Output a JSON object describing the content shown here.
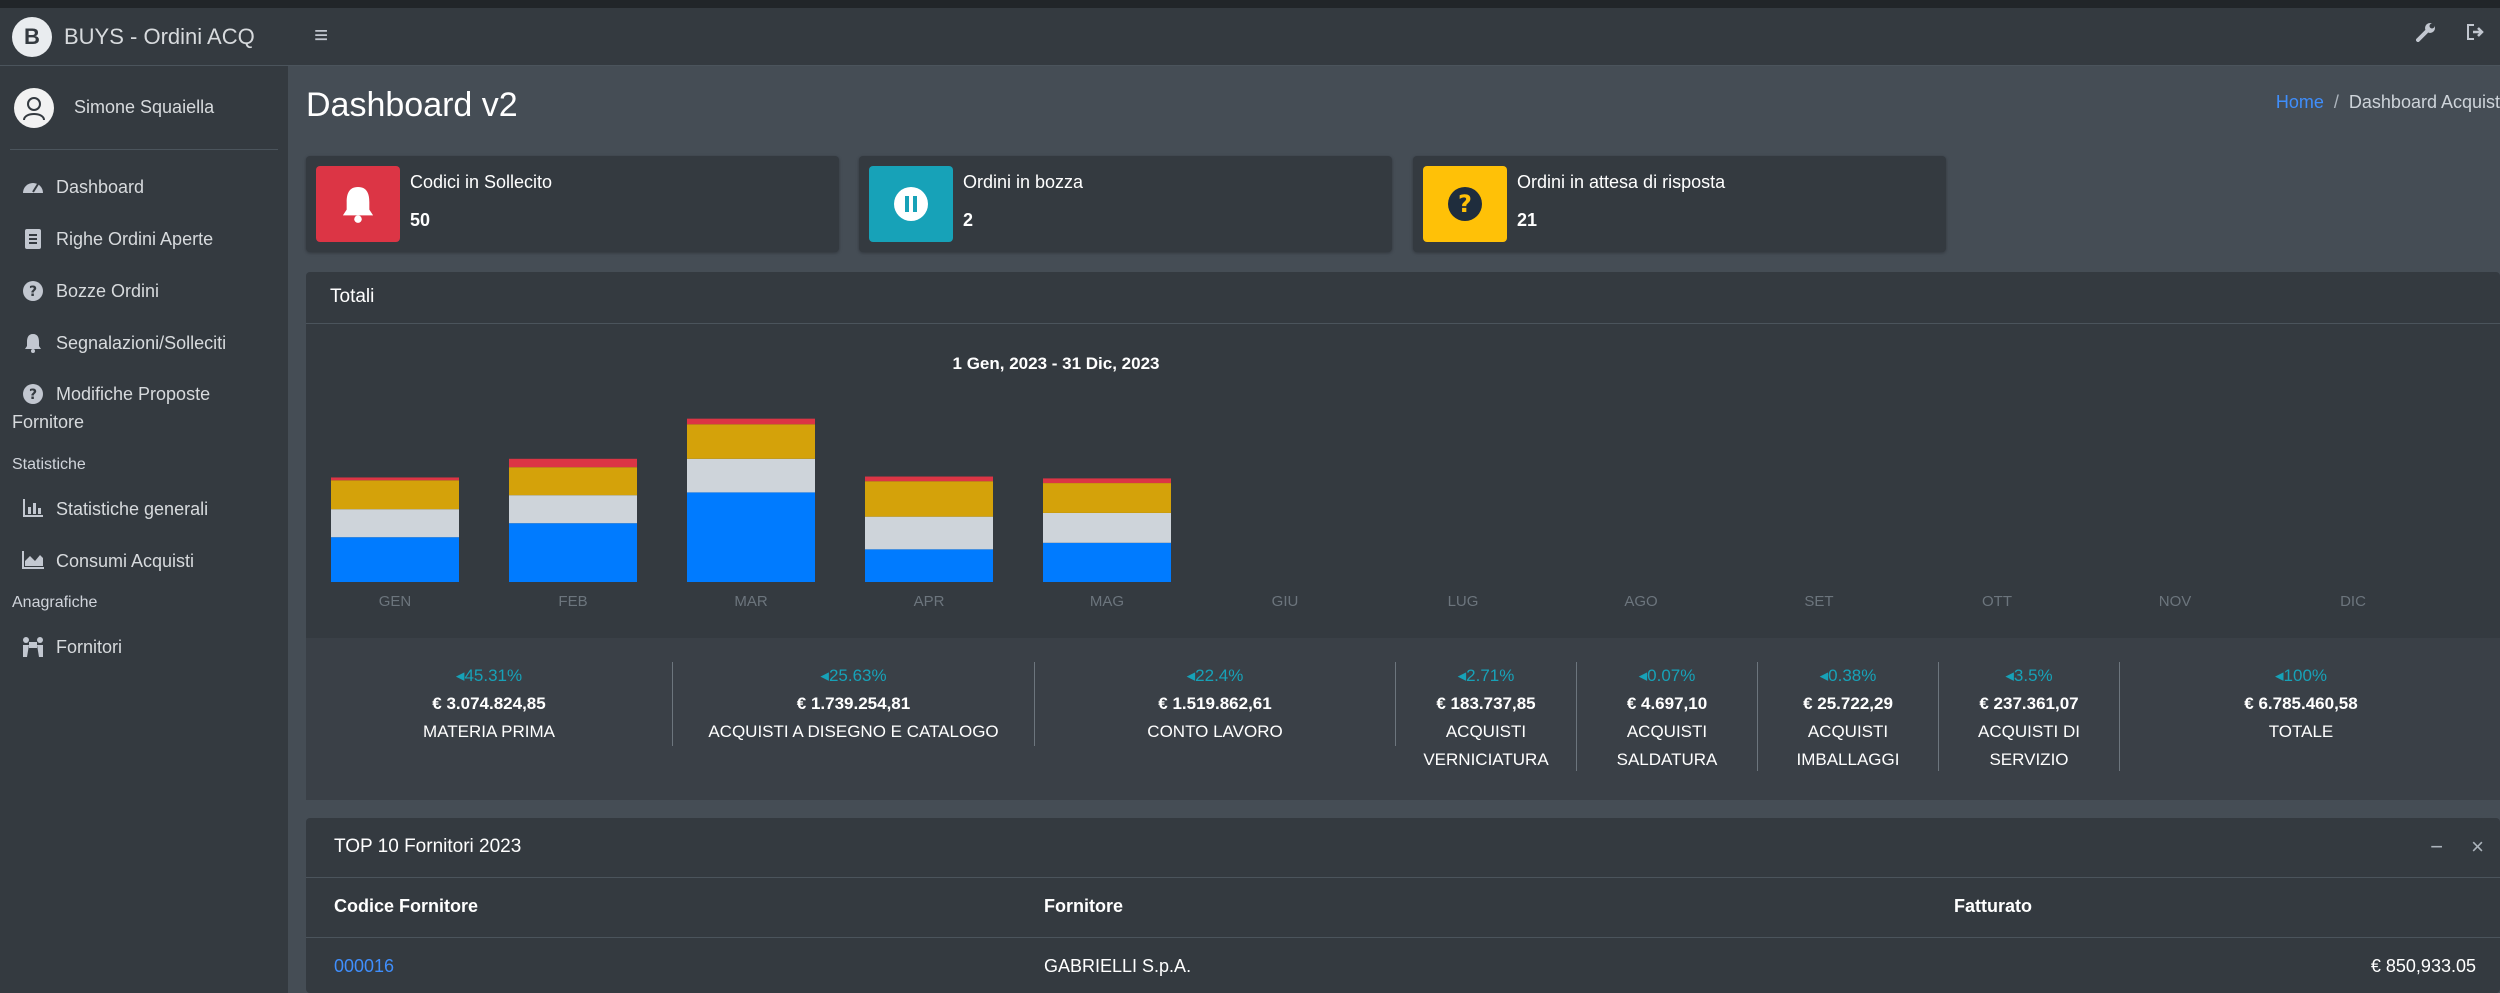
{
  "app": {
    "brand": "BUYS - Ordini ACQ",
    "user": "Simone Squaiella"
  },
  "sidebar": {
    "items": [
      {
        "label": "Dashboard",
        "icon": "tachometer-icon"
      },
      {
        "label": "Righe Ordini Aperte",
        "icon": "file-list-icon"
      },
      {
        "label": "Bozze Ordini",
        "icon": "question-circle-icon"
      },
      {
        "label": "Segnalazioni/Solleciti",
        "icon": "bell-icon"
      },
      {
        "label_line1": "Modifiche Proposte",
        "label_line2": "Fornitore",
        "icon": "question-circle-icon"
      }
    ],
    "header_statistiche": "Statistiche",
    "statistiche": [
      {
        "label": "Statistiche generali",
        "icon": "bar-chart-icon"
      },
      {
        "label": "Consumi Acquisti",
        "icon": "area-chart-icon"
      }
    ],
    "header_anagrafiche": "Anagrafiche",
    "anagrafiche": [
      {
        "label": "Fornitori",
        "icon": "people-carry-icon"
      }
    ]
  },
  "page": {
    "title": "Dashboard v2"
  },
  "breadcrumb": {
    "home": "Home",
    "current": "Dashboard Acquist"
  },
  "info_boxes": [
    {
      "label": "Codici in Sollecito",
      "value": "50",
      "color": "#dc3545",
      "icon": "bell-icon"
    },
    {
      "label": "Ordini in bozza",
      "value": "2",
      "color": "#17a2b8",
      "icon": "pause-icon"
    },
    {
      "label": "Ordini in attesa di risposta",
      "value": "21",
      "color": "#ffc107",
      "icon": "question-circle-icon"
    }
  ],
  "totali": {
    "header": "Totali",
    "chart_data": {
      "type": "bar",
      "stacked": true,
      "title": "1 Gen, 2023 - 31 Dic, 2023",
      "categories": [
        "GEN",
        "FEB",
        "MAR",
        "APR",
        "MAG",
        "GIU",
        "LUG",
        "AGO",
        "SET",
        "OTT",
        "NOV",
        "DIC"
      ],
      "series": [
        {
          "color": "#007bff",
          "values": [
            48,
            63,
            96,
            35,
            42,
            0,
            0,
            0,
            0,
            0,
            0,
            0
          ]
        },
        {
          "color": "#ced4da",
          "values": [
            30,
            30,
            36,
            35,
            32,
            0,
            0,
            0,
            0,
            0,
            0,
            0
          ]
        },
        {
          "color": "#d4a20a",
          "values": [
            31,
            30,
            37,
            38,
            32,
            0,
            0,
            0,
            0,
            0,
            0,
            0
          ]
        },
        {
          "color": "#dc3545",
          "values": [
            3,
            9,
            6,
            5,
            5,
            0,
            0,
            0,
            0,
            0,
            0,
            0
          ]
        }
      ],
      "ylim": [
        0,
        180
      ]
    },
    "stats": [
      {
        "pct": "45.31%",
        "value": "€ 3.074.824,85",
        "label": "MATERIA PRIMA"
      },
      {
        "pct": "25.63%",
        "value": "€ 1.739.254,81",
        "label": "ACQUISTI A DISEGNO E CATALOGO"
      },
      {
        "pct": "22.4%",
        "value": "€ 1.519.862,61",
        "label": "CONTO LAVORO"
      },
      {
        "pct": "2.71%",
        "value": "€ 183.737,85",
        "label1": "ACQUISTI",
        "label2": "VERNICIATURA"
      },
      {
        "pct": "0.07%",
        "value": "€ 4.697,10",
        "label1": "ACQUISTI",
        "label2": "SALDATURA"
      },
      {
        "pct": "0.38%",
        "value": "€ 25.722,29",
        "label1": "ACQUISTI",
        "label2": "IMBALLAGGI"
      },
      {
        "pct": "3.5%",
        "value": "€ 237.361,07",
        "label1": "ACQUISTI DI",
        "label2": "SERVIZIO"
      },
      {
        "pct": "100%",
        "value": "€ 6.785.460,58",
        "label": "TOTALE"
      }
    ]
  },
  "top10": {
    "header": "TOP 10 Fornitori 2023",
    "minimize": "−",
    "close": "×",
    "columns": [
      "Codice Fornitore",
      "Fornitore",
      "Fatturato"
    ],
    "rows": [
      {
        "code": "000016",
        "name": "GABRIELLI S.p.A.",
        "amount": "€ 850,933.05"
      }
    ]
  }
}
